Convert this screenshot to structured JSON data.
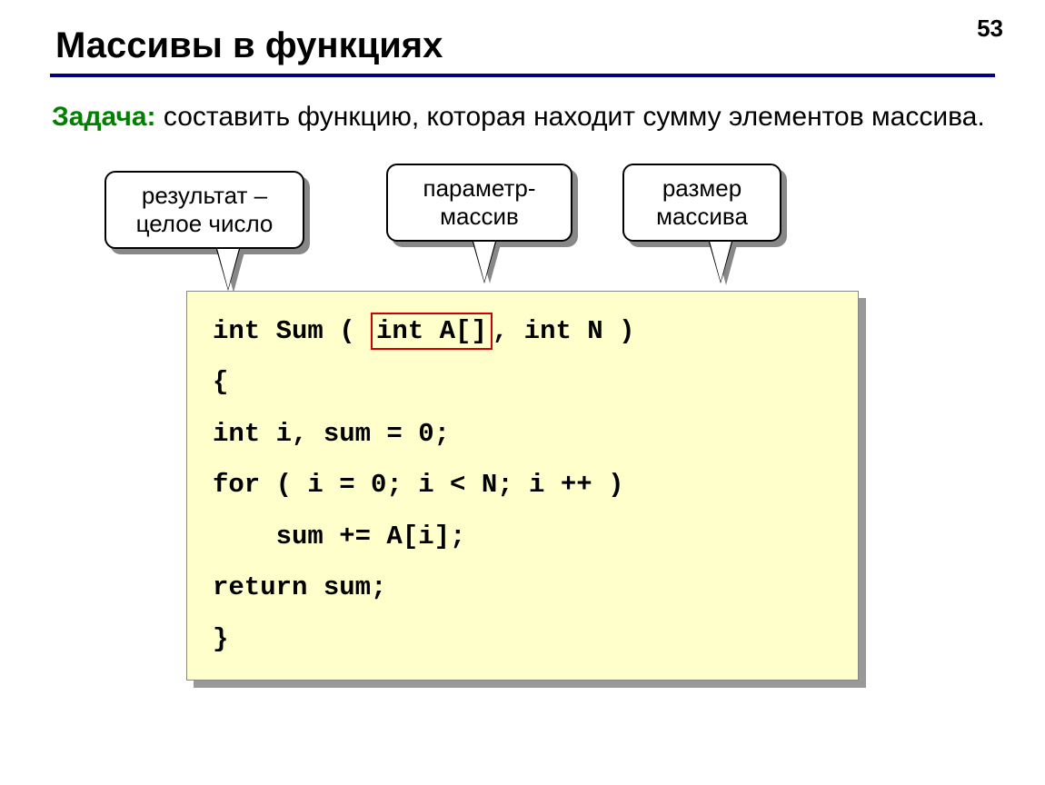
{
  "page_number": "53",
  "heading": "Массивы в функциях",
  "task_label": "Задача:",
  "task_text": " составить функцию, которая находит сумму элементов массива.",
  "callouts": {
    "c1_line1": "результат –",
    "c1_line2": "целое число",
    "c2_line1": "параметр-",
    "c2_line2": "массив",
    "c3_line1": "размер",
    "c3_line2": "массива"
  },
  "code": {
    "l1a": "int Sum ( ",
    "l1_boxed": "int A[]",
    "l1b": ", int N )",
    "l2": "{",
    "l3": "int i, sum = 0;",
    "l4": "for ( i = 0; i < N; i ++ )",
    "l5": "    sum += A[i];",
    "l6": "return sum;",
    "l7": "}"
  }
}
